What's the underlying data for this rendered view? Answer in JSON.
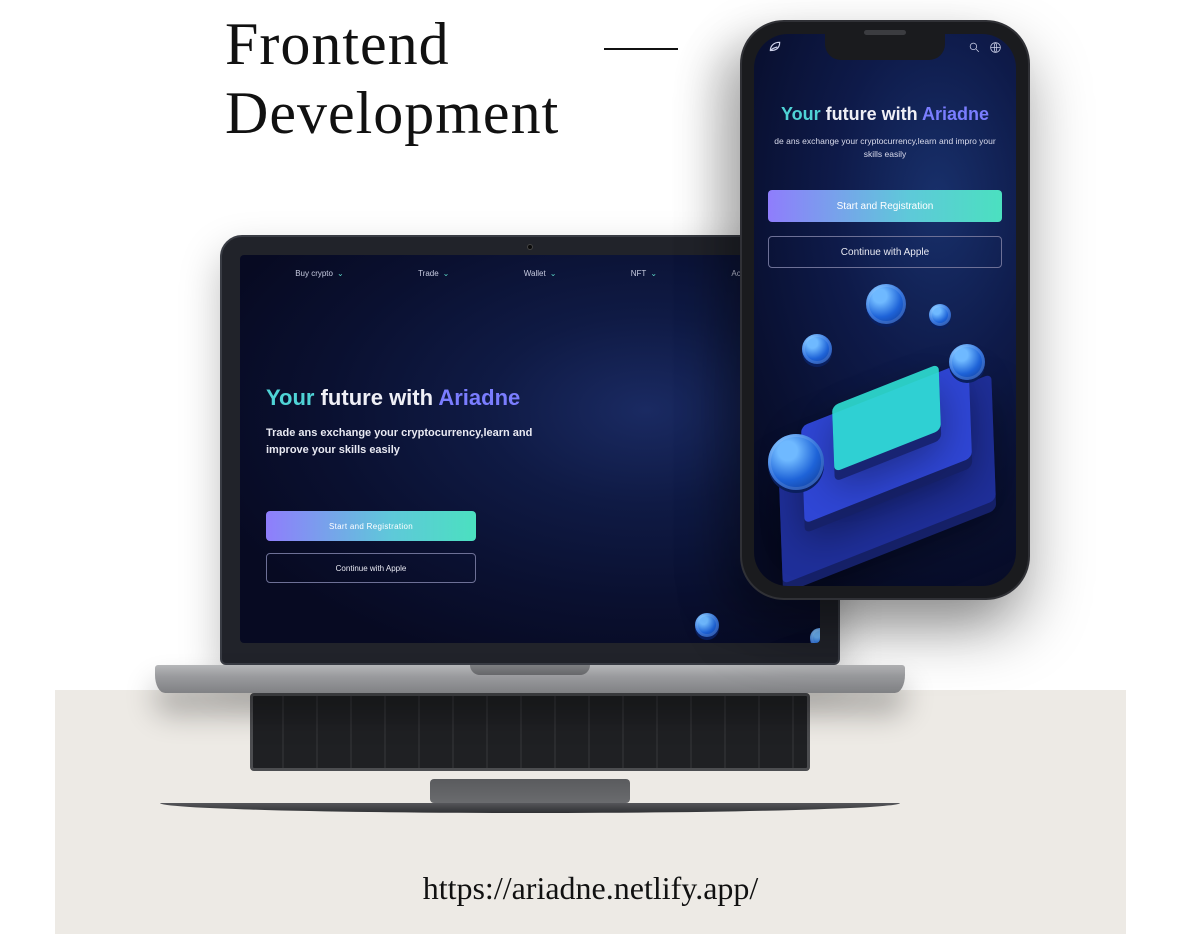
{
  "heading": {
    "line1": "Frontend",
    "line2": "Development"
  },
  "url": "https://ariadne.netlify.app/",
  "nav": {
    "items": [
      {
        "label": "Buy crypto"
      },
      {
        "label": "Trade"
      },
      {
        "label": "Wallet"
      },
      {
        "label": "NFT"
      },
      {
        "label": "Academy"
      }
    ]
  },
  "hero": {
    "word_your": "Your",
    "word_future": "future",
    "word_with": "with",
    "word_brand": "Ariadne",
    "subtitle_laptop": "Trade ans exchange your cryptocurrency,learn and improve your skills easily",
    "subtitle_phone": "de ans exchange your cryptocurrency,learn and impro your skills easily"
  },
  "buttons": {
    "primary": "Start and Registration",
    "outline": "Continue with Apple"
  },
  "colors": {
    "bg_page": "#ffffff",
    "bg_strip": "#edeae5",
    "screen_dark": "#0a1030",
    "accent_cyan": "#4fd3d6",
    "accent_purple": "#7a7dff",
    "gradient_start": "#8f7dfc",
    "gradient_mid": "#5ec9d9",
    "gradient_end": "#4be0c0"
  },
  "icons": {
    "logo": "leaf-icon",
    "search": "search-icon",
    "globe": "globe-icon",
    "chevron": "chevron-down-icon"
  }
}
